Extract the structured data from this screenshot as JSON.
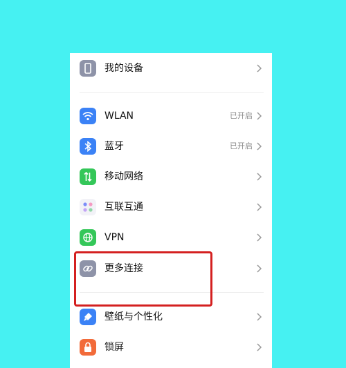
{
  "settings": {
    "items": [
      {
        "label": "我的设备",
        "status": "",
        "icon": "phone-icon",
        "color": "#8e93a8"
      },
      {
        "label": "WLAN",
        "status": "已开启",
        "icon": "wifi-icon",
        "color": "#3b82f6"
      },
      {
        "label": "蓝牙",
        "status": "已开启",
        "icon": "bluetooth-icon",
        "color": "#3b82f6"
      },
      {
        "label": "移动网络",
        "status": "",
        "icon": "cellular-icon",
        "color": "#34c759"
      },
      {
        "label": "互联互通",
        "status": "",
        "icon": "interconnect-icon",
        "color": "#f2f2f7"
      },
      {
        "label": "VPN",
        "status": "",
        "icon": "globe-icon",
        "color": "#34c759"
      },
      {
        "label": "更多连接",
        "status": "",
        "icon": "link-icon",
        "color": "#8e93a8"
      },
      {
        "label": "壁纸与个性化",
        "status": "",
        "icon": "brush-icon",
        "color": "#3b82f6"
      },
      {
        "label": "锁屏",
        "status": "",
        "icon": "lock-icon",
        "color": "#f26b3a"
      }
    ]
  },
  "colors": {
    "background": "#46F1F2",
    "highlight": "#d42020"
  }
}
